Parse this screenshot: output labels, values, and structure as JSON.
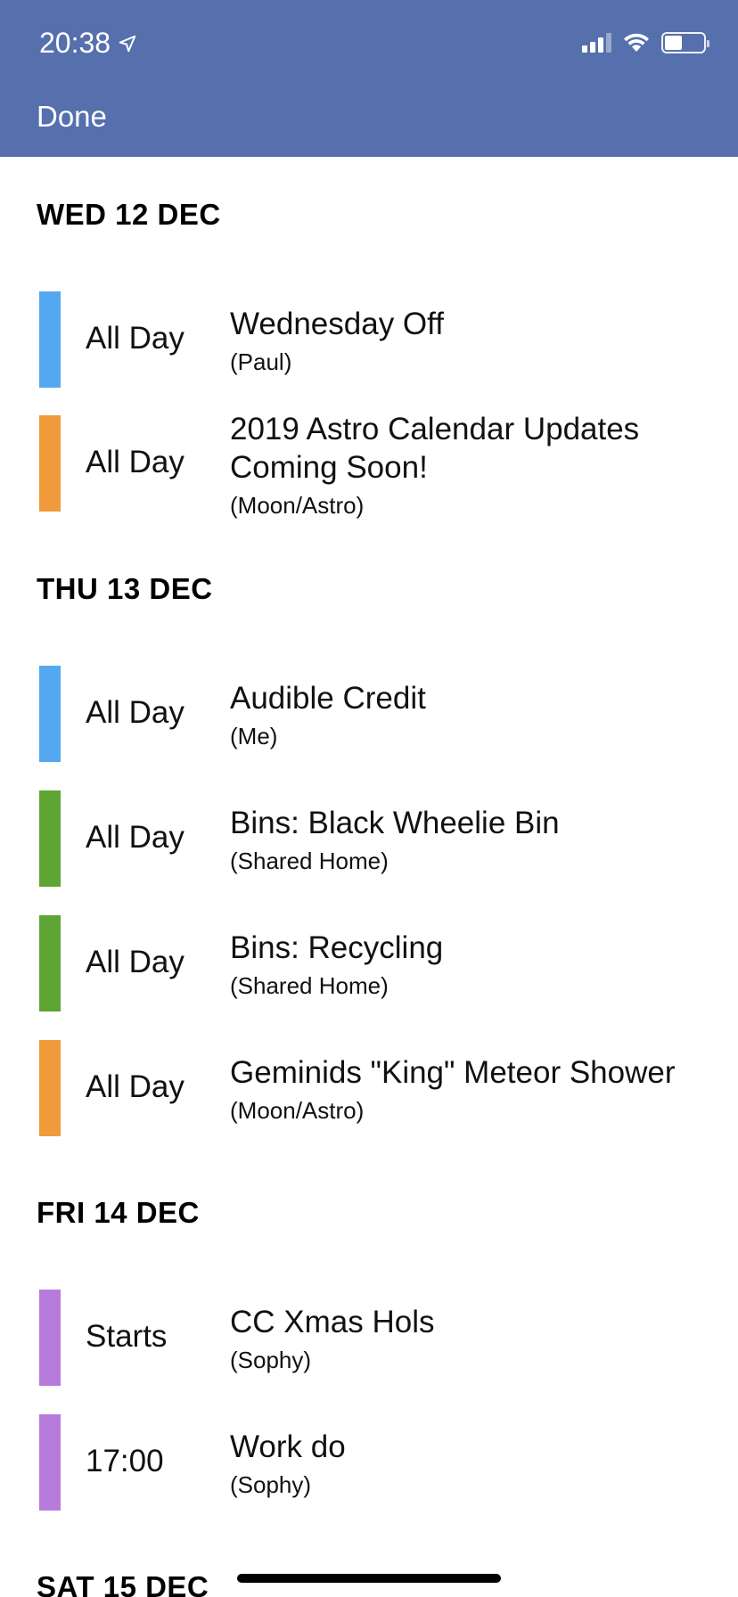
{
  "status_bar": {
    "time": "20:38"
  },
  "nav": {
    "done_label": "Done"
  },
  "colors": {
    "header": "#5570ad",
    "blue": "#54a8ef",
    "orange": "#f09a3b",
    "green": "#5fa533",
    "purple": "#b87bdc"
  },
  "days": [
    {
      "heading": "WED 12 DEC",
      "events": [
        {
          "time": "All Day",
          "title": "Wednesday Off",
          "calendar": "(Paul)",
          "color": "blue"
        },
        {
          "time": "All Day",
          "title": "2019 Astro Calendar Updates Coming Soon!",
          "calendar": "(Moon/Astro)",
          "color": "orange"
        }
      ]
    },
    {
      "heading": "THU 13 DEC",
      "events": [
        {
          "time": "All Day",
          "title": "Audible Credit",
          "calendar": "(Me)",
          "color": "blue"
        },
        {
          "time": "All Day",
          "title": "Bins: Black Wheelie Bin",
          "calendar": "(Shared Home)",
          "color": "green"
        },
        {
          "time": "All Day",
          "title": "Bins: Recycling",
          "calendar": "(Shared Home)",
          "color": "green"
        },
        {
          "time": "All Day",
          "title": "Geminids \"King\" Meteor Shower",
          "calendar": "(Moon/Astro)",
          "color": "orange"
        }
      ]
    },
    {
      "heading": "FRI 14 DEC",
      "events": [
        {
          "time": "Starts",
          "title": "CC Xmas Hols",
          "calendar": "(Sophy)",
          "color": "purple"
        },
        {
          "time": "17:00",
          "title": "Work do",
          "calendar": "(Sophy)",
          "color": "purple"
        }
      ]
    },
    {
      "heading": "SAT 15 DEC",
      "events": []
    }
  ]
}
